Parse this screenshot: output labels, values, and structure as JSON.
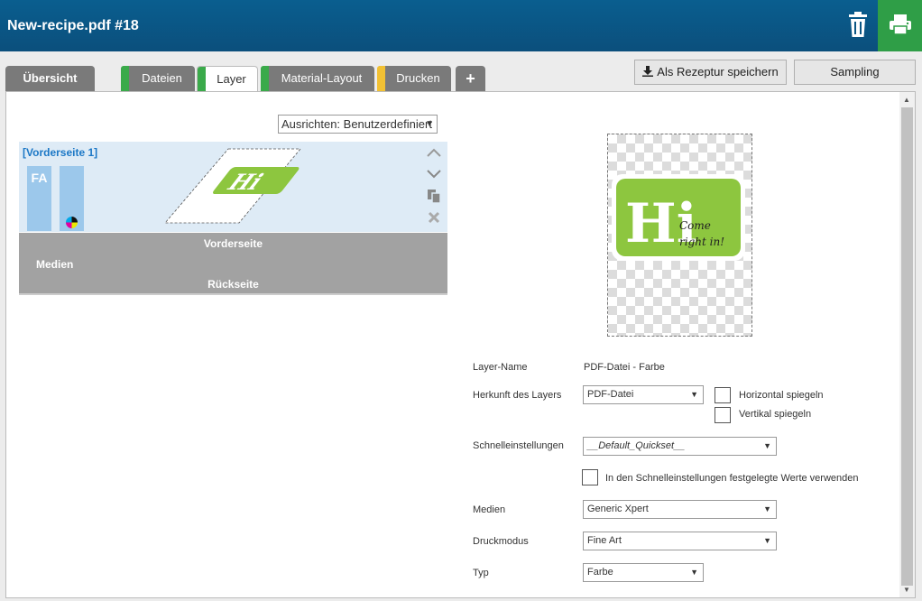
{
  "window": {
    "title": "New-recipe.pdf #18"
  },
  "tabs": {
    "overview": "Übersicht",
    "files": "Dateien",
    "layer": "Layer",
    "material_layout": "Material-Layout",
    "print": "Drucken",
    "add": "+"
  },
  "tab_stripes": {
    "files": "#3aaa4a",
    "layer": "#3aaa4a",
    "material_layout": "#3aaa4a",
    "print": "#f2c133"
  },
  "toolbar": {
    "save_recipe": "Als Rezeptur speichern",
    "sampling": "Sampling"
  },
  "align_select": {
    "value": "Ausrichten: Benutzerdefiniert"
  },
  "layer_card": {
    "title": "[Vorderseite 1]",
    "fa_label": "FA"
  },
  "logo": {
    "big": "Hi",
    "tagline_1": "Come",
    "tagline_2": "right in!",
    "color": "#8dc63f"
  },
  "media_box": {
    "front": "Vorderseite",
    "media": "Medien",
    "back": "Rückseite"
  },
  "form": {
    "layer_name_label": "Layer-Name",
    "layer_name_value": "PDF-Datei - Farbe",
    "origin_label": "Herkunft des Layers",
    "origin_value": "PDF-Datei",
    "flip_h": "Horizontal spiegeln",
    "flip_v": "Vertikal spiegeln",
    "quickset_label": "Schnelleinstellungen",
    "quickset_value": "__Default_Quickset__",
    "use_quickset": "In den Schnelleinstellungen festgelegte Werte verwenden",
    "media_label": "Medien",
    "media_value": "Generic Xpert",
    "printmode_label": "Druckmodus",
    "printmode_value": "Fine Art",
    "type_label": "Typ",
    "type_value": "Farbe"
  }
}
